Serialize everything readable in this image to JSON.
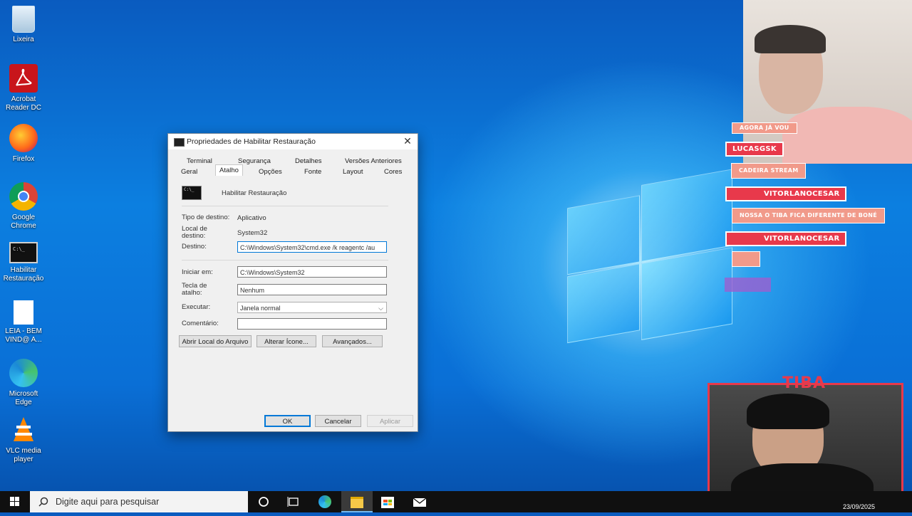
{
  "desktop": {
    "icons": [
      {
        "label": "Lixeira",
        "icon": "recycle-bin-icon"
      },
      {
        "label": "Acrobat Reader DC",
        "icon": "acrobat-icon"
      },
      {
        "label": "Firefox",
        "icon": "firefox-icon"
      },
      {
        "label": "Google Chrome",
        "icon": "chrome-icon"
      },
      {
        "label": "Habilitar Restauração",
        "icon": "cmd-shortcut-icon"
      },
      {
        "label": "LEIA - BEM VIND@ A...",
        "icon": "text-file-icon"
      },
      {
        "label": "Microsoft Edge",
        "icon": "edge-icon"
      },
      {
        "label": "VLC media player",
        "icon": "vlc-icon"
      }
    ]
  },
  "dialog": {
    "title": "Propriedades de Habilitar Restauração",
    "tabs_row1": [
      "Terminal",
      "Segurança",
      "Detalhes",
      "Versões Anteriores"
    ],
    "tabs_row2": [
      "Geral",
      "Atalho",
      "Opções",
      "Fonte",
      "Layout",
      "Cores"
    ],
    "active_tab": "Atalho",
    "shortcut_name": "Habilitar Restauração",
    "tipo_destino_label": "Tipo de destino:",
    "tipo_destino_value": "Aplicativo",
    "local_destino_label": "Local de destino:",
    "local_destino_value": "System32",
    "destino_label": "Destino:",
    "destino_value": "C:\\Windows\\System32\\cmd.exe /k reagentc /au",
    "iniciar_label": "Iniciar em:",
    "iniciar_value": "C:\\Windows\\System32",
    "tecla_label": "Tecla de atalho:",
    "tecla_value": "Nenhum",
    "executar_label": "Executar:",
    "executar_value": "Janela normal",
    "comentario_label": "Comentário:",
    "comentario_value": "",
    "btn_abrir": "Abrir Local do Arquivo",
    "btn_alterar": "Alterar Ícone...",
    "btn_avancados": "Avançados...",
    "btn_ok": "OK",
    "btn_cancelar": "Cancelar",
    "btn_aplicar": "Aplicar"
  },
  "taskbar": {
    "search_placeholder": "Digite aqui para pesquisar",
    "date": "23/09/2025"
  },
  "stream": {
    "chat": [
      {
        "type": "msg",
        "text": "AGORA JÁ VOU"
      },
      {
        "type": "name",
        "text": "LUCASGSK"
      },
      {
        "type": "msg",
        "text": "CADEIRA STREAM"
      },
      {
        "type": "name",
        "text": "VITORLANOCESAR"
      },
      {
        "type": "msg",
        "text": "NOSSA O TIBA FICA DIFERENTE DE BONÉ"
      },
      {
        "type": "name",
        "text": "VITORLANOCESAR"
      }
    ],
    "streamer_tag": "TIBA"
  }
}
